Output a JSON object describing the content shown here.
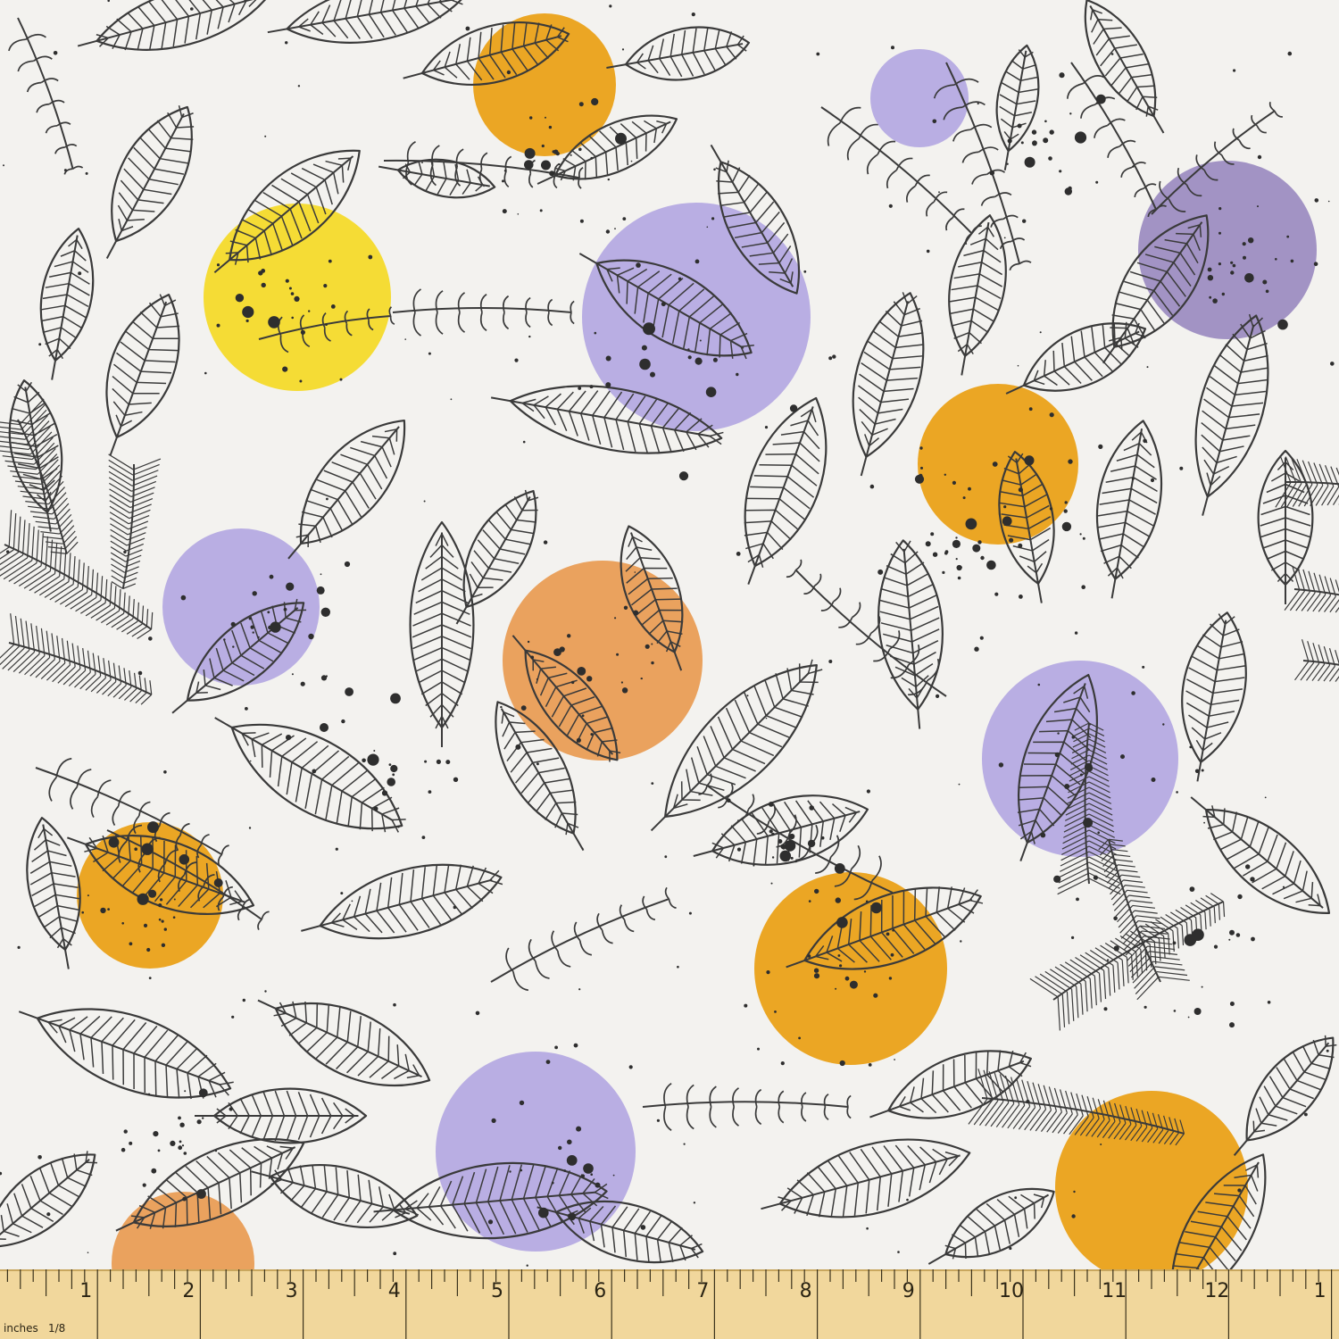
{
  "colors": {
    "background": "#f3f2ef",
    "line": "#3a3a3a",
    "ink": "#2e2e2e",
    "orange": "#eba624",
    "yellow": "#f5dc35",
    "lavender": "#b9aee3",
    "peach": "#eaa25e",
    "mauve": "#a293c4",
    "ruler": "#f1d79c",
    "ruler_edge": "#c9a75e"
  },
  "pattern": {
    "motifs": [
      "leaf-icon",
      "fern-sprig-icon",
      "color-dot",
      "ink-splatter"
    ],
    "dot_colors": [
      "orange",
      "yellow",
      "lavender",
      "peach",
      "mauve"
    ]
  },
  "ruler": {
    "unit_label": "inches",
    "fraction_label": "1/8",
    "numbers": [
      "1",
      "2",
      "3",
      "4",
      "5",
      "6",
      "7",
      "8",
      "9",
      "10",
      "11",
      "12",
      "1"
    ]
  }
}
